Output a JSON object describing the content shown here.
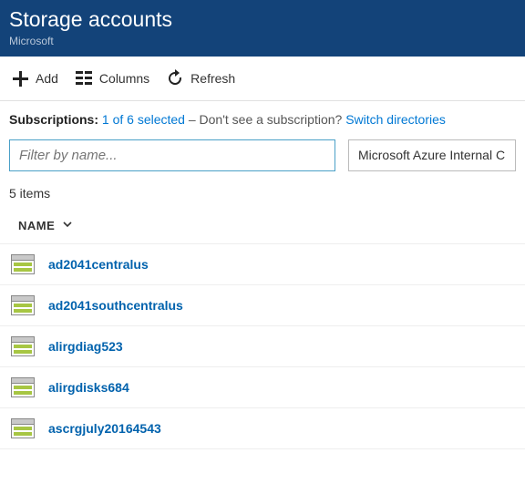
{
  "header": {
    "title": "Storage accounts",
    "subtitle": "Microsoft"
  },
  "toolbar": {
    "add_label": "Add",
    "columns_label": "Columns",
    "refresh_label": "Refresh"
  },
  "subscriptions": {
    "label": "Subscriptions:",
    "selected_text": "1 of 6 selected",
    "prompt": " – Don't see a subscription? ",
    "switch_link": "Switch directories"
  },
  "filters": {
    "name_placeholder": "Filter by name...",
    "scope_selected": "Microsoft Azure Internal C"
  },
  "list": {
    "count_text": "5 items",
    "column_header": "NAME",
    "items": [
      {
        "name": "ad2041centralus"
      },
      {
        "name": "ad2041southcentralus"
      },
      {
        "name": "alirgdiag523"
      },
      {
        "name": "alirgdisks684"
      },
      {
        "name": "ascrgjuly20164543"
      }
    ]
  }
}
